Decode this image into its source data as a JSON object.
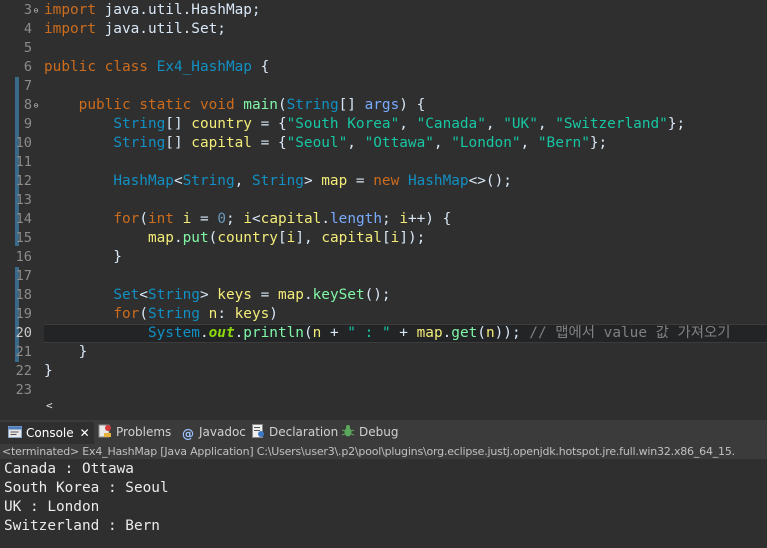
{
  "editor": {
    "line_numbers": [
      "3",
      "4",
      "5",
      "6",
      "7",
      "8",
      "9",
      "10",
      "11",
      "12",
      "13",
      "14",
      "15",
      "16",
      "17",
      "18",
      "19",
      "20",
      "21",
      "22",
      "23"
    ],
    "lines": {
      "l3": [
        {
          "t": "import",
          "c": "kw"
        },
        {
          "t": " java.util.HashMap;",
          "c": ""
        }
      ],
      "l4": [
        {
          "t": "import",
          "c": "kw"
        },
        {
          "t": " java.util.Set;",
          "c": ""
        }
      ],
      "l5": [],
      "l6": [
        {
          "t": "public",
          "c": "kw"
        },
        {
          "t": " ",
          "c": ""
        },
        {
          "t": "class",
          "c": "kw"
        },
        {
          "t": " ",
          "c": ""
        },
        {
          "t": "Ex4_HashMap",
          "c": "ty"
        },
        {
          "t": " {",
          "c": ""
        }
      ],
      "l7": [],
      "l8": [
        {
          "t": "    ",
          "c": ""
        },
        {
          "t": "public",
          "c": "kw"
        },
        {
          "t": " ",
          "c": ""
        },
        {
          "t": "static",
          "c": "kw"
        },
        {
          "t": " ",
          "c": ""
        },
        {
          "t": "void",
          "c": "kw"
        },
        {
          "t": " ",
          "c": ""
        },
        {
          "t": "main",
          "c": "mt"
        },
        {
          "t": "(",
          "c": ""
        },
        {
          "t": "String",
          "c": "ty"
        },
        {
          "t": "[] ",
          "c": ""
        },
        {
          "t": "args",
          "c": "par"
        },
        {
          "t": ") {",
          "c": ""
        }
      ],
      "l9": [
        {
          "t": "        ",
          "c": ""
        },
        {
          "t": "String",
          "c": "ty"
        },
        {
          "t": "[] ",
          "c": ""
        },
        {
          "t": "country",
          "c": "var"
        },
        {
          "t": " = {",
          "c": ""
        },
        {
          "t": "\"South Korea\"",
          "c": "st"
        },
        {
          "t": ", ",
          "c": ""
        },
        {
          "t": "\"Canada\"",
          "c": "st"
        },
        {
          "t": ", ",
          "c": ""
        },
        {
          "t": "\"UK\"",
          "c": "st"
        },
        {
          "t": ", ",
          "c": ""
        },
        {
          "t": "\"Switzerland\"",
          "c": "st"
        },
        {
          "t": "};",
          "c": ""
        }
      ],
      "l10": [
        {
          "t": "        ",
          "c": ""
        },
        {
          "t": "String",
          "c": "ty"
        },
        {
          "t": "[] ",
          "c": ""
        },
        {
          "t": "capital",
          "c": "var"
        },
        {
          "t": " = {",
          "c": ""
        },
        {
          "t": "\"Seoul\"",
          "c": "st"
        },
        {
          "t": ", ",
          "c": ""
        },
        {
          "t": "\"Ottawa\"",
          "c": "st"
        },
        {
          "t": ", ",
          "c": ""
        },
        {
          "t": "\"London\"",
          "c": "st"
        },
        {
          "t": ", ",
          "c": ""
        },
        {
          "t": "\"Bern\"",
          "c": "st"
        },
        {
          "t": "};",
          "c": ""
        }
      ],
      "l11": [],
      "l12": [
        {
          "t": "        ",
          "c": ""
        },
        {
          "t": "HashMap",
          "c": "ty"
        },
        {
          "t": "<",
          "c": ""
        },
        {
          "t": "String",
          "c": "ty"
        },
        {
          "t": ", ",
          "c": ""
        },
        {
          "t": "String",
          "c": "ty"
        },
        {
          "t": "> ",
          "c": ""
        },
        {
          "t": "map",
          "c": "var"
        },
        {
          "t": " = ",
          "c": ""
        },
        {
          "t": "new",
          "c": "kw"
        },
        {
          "t": " ",
          "c": ""
        },
        {
          "t": "HashMap",
          "c": "ty"
        },
        {
          "t": "<>();",
          "c": ""
        }
      ],
      "l13": [],
      "l14": [
        {
          "t": "        ",
          "c": ""
        },
        {
          "t": "for",
          "c": "kw"
        },
        {
          "t": "(",
          "c": ""
        },
        {
          "t": "int",
          "c": "kw"
        },
        {
          "t": " ",
          "c": ""
        },
        {
          "t": "i",
          "c": "var"
        },
        {
          "t": " = ",
          "c": ""
        },
        {
          "t": "0",
          "c": "nm"
        },
        {
          "t": "; ",
          "c": ""
        },
        {
          "t": "i",
          "c": "var"
        },
        {
          "t": "<",
          "c": ""
        },
        {
          "t": "capital",
          "c": "var"
        },
        {
          "t": ".",
          "c": ""
        },
        {
          "t": "length",
          "c": "par"
        },
        {
          "t": "; ",
          "c": ""
        },
        {
          "t": "i",
          "c": "var"
        },
        {
          "t": "++) {",
          "c": ""
        }
      ],
      "l15": [
        {
          "t": "            ",
          "c": ""
        },
        {
          "t": "map",
          "c": "var"
        },
        {
          "t": ".",
          "c": ""
        },
        {
          "t": "put",
          "c": "mt"
        },
        {
          "t": "(",
          "c": ""
        },
        {
          "t": "country",
          "c": "var"
        },
        {
          "t": "[",
          "c": ""
        },
        {
          "t": "i",
          "c": "var"
        },
        {
          "t": "], ",
          "c": ""
        },
        {
          "t": "capital",
          "c": "var"
        },
        {
          "t": "[",
          "c": ""
        },
        {
          "t": "i",
          "c": "var"
        },
        {
          "t": "]);",
          "c": ""
        }
      ],
      "l16": [
        {
          "t": "        }",
          "c": ""
        }
      ],
      "l17": [],
      "l18": [
        {
          "t": "        ",
          "c": ""
        },
        {
          "t": "Set",
          "c": "ty"
        },
        {
          "t": "<",
          "c": ""
        },
        {
          "t": "String",
          "c": "ty"
        },
        {
          "t": "> ",
          "c": ""
        },
        {
          "t": "keys",
          "c": "var"
        },
        {
          "t": " = ",
          "c": ""
        },
        {
          "t": "map",
          "c": "var"
        },
        {
          "t": ".",
          "c": ""
        },
        {
          "t": "keySet",
          "c": "mt"
        },
        {
          "t": "();",
          "c": ""
        }
      ],
      "l19": [
        {
          "t": "        ",
          "c": ""
        },
        {
          "t": "for",
          "c": "kw"
        },
        {
          "t": "(",
          "c": ""
        },
        {
          "t": "String",
          "c": "ty"
        },
        {
          "t": " ",
          "c": ""
        },
        {
          "t": "n",
          "c": "var"
        },
        {
          "t": ": ",
          "c": ""
        },
        {
          "t": "keys",
          "c": "var"
        },
        {
          "t": ")",
          "c": ""
        }
      ],
      "l20": [
        {
          "t": "            ",
          "c": ""
        },
        {
          "t": "System",
          "c": "ty"
        },
        {
          "t": ".",
          "c": ""
        },
        {
          "t": "out",
          "c": "static-field"
        },
        {
          "t": ".",
          "c": ""
        },
        {
          "t": "println",
          "c": "mt"
        },
        {
          "t": "(",
          "c": ""
        },
        {
          "t": "n",
          "c": "var"
        },
        {
          "t": " + ",
          "c": ""
        },
        {
          "t": "\" : \"",
          "c": "st"
        },
        {
          "t": " + ",
          "c": ""
        },
        {
          "t": "map",
          "c": "var"
        },
        {
          "t": ".",
          "c": ""
        },
        {
          "t": "get",
          "c": "mt"
        },
        {
          "t": "(",
          "c": ""
        },
        {
          "t": "n",
          "c": "var"
        },
        {
          "t": ")); ",
          "c": ""
        },
        {
          "t": "// 맵에서 value 값 가져오기",
          "c": "cm"
        }
      ],
      "l21": [
        {
          "t": "    }",
          "c": ""
        }
      ],
      "l22": [
        {
          "t": "}",
          "c": ""
        }
      ],
      "l23": []
    },
    "scroll_left": "<"
  },
  "console": {
    "tabs": {
      "console": "Console",
      "problems": "Problems",
      "javadoc": "Javadoc",
      "declaration": "Declaration",
      "debug": "Debug"
    },
    "close": "✕",
    "terminated": "<terminated> Ex4_HashMap [Java Application] C:\\Users\\user3\\.p2\\pool\\plugins\\org.eclipse.justj.openjdk.hotspot.jre.full.win32.x86_64_15.",
    "output": [
      "Canada : Ottawa",
      "South Korea : Seoul",
      "UK : London",
      "Switzerland : Bern"
    ]
  },
  "icons": {
    "console": "console-icon",
    "problems": "problems-icon",
    "javadoc": "javadoc-icon",
    "declaration": "declaration-icon",
    "debug": "debug-icon"
  },
  "colors": {
    "background": "#2f2f2f",
    "keyword": "#cc6c1d",
    "type": "#1290c3",
    "string": "#17c6a3",
    "method": "#80f6a7",
    "variable": "#f3ec79"
  }
}
